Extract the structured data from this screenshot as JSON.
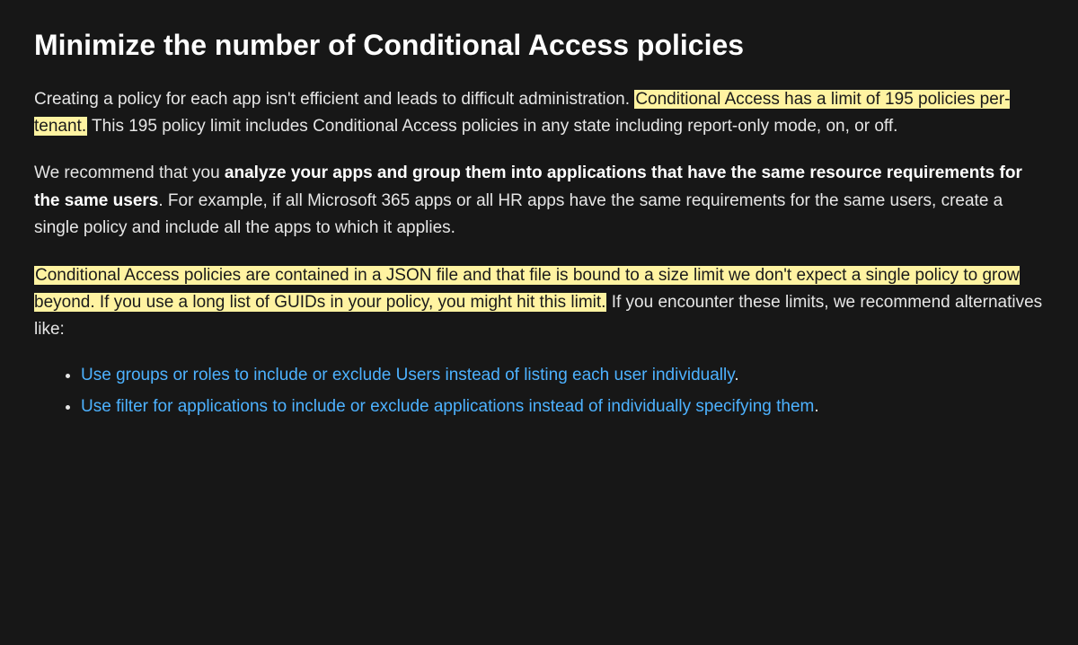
{
  "heading": "Minimize the number of Conditional Access policies",
  "para1": {
    "t1": "Creating a policy for each app isn't efficient and leads to difficult administration. ",
    "hl1": "Conditional Access has a limit of 195 policies per-tenant.",
    "t2": " This 195 policy limit includes Conditional Access policies in any state including report-only mode, on, or off."
  },
  "para2": {
    "t1": "We recommend that you ",
    "b1": "analyze your apps and group them into applications that have the same resource requirements for the same users",
    "t2": ". For example, if all Microsoft 365 apps or all HR apps have the same requirements for the same users, create a single policy and include all the apps to which it applies."
  },
  "para3": {
    "hl1": "Conditional Access policies are contained in a JSON file and that file is bound to a size limit we don't expect a single policy to grow beyond. If you use a long list of GUIDs in your policy, you might hit this limit.",
    "t1": " If you encounter these limits, we recommend alternatives like:"
  },
  "list": {
    "item1": "Use groups or roles to include or exclude Users instead of listing each user individually",
    "item2": "Use filter for applications to include or exclude applications instead of individually specifying them",
    "punct": "."
  }
}
